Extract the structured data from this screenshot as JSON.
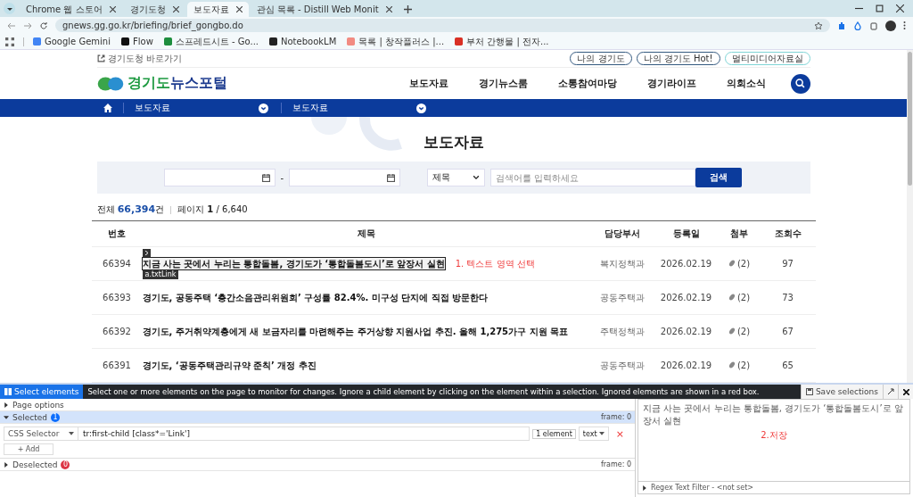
{
  "browser": {
    "tabs": [
      {
        "title": "Chrome 웹 스토어",
        "selected": false
      },
      {
        "title": "경기도청",
        "selected": false
      },
      {
        "title": "보도자료",
        "selected": true
      },
      {
        "title": "관심 목록 - Distill Web Monit",
        "selected": false
      }
    ],
    "url": "gnews.gg.go.kr/briefing/brief_gongbo.do",
    "bookmarks": [
      {
        "label": "Google Gemini"
      },
      {
        "label": "Flow"
      },
      {
        "label": "스프레드시트 - Go..."
      },
      {
        "label": "NotebookLM"
      },
      {
        "label": "목록 | 창작플러스 |..."
      },
      {
        "label": "부처 간행물 | 전자..."
      }
    ]
  },
  "site": {
    "top_link": "경기도청 바로가기",
    "top_buttons": [
      "나의 경기도",
      "나의 경기도 Hot!",
      "멀티미디어자료실"
    ],
    "logo": {
      "primary": "경기도",
      "secondary": "뉴스포털"
    },
    "menu": [
      "보도자료",
      "경기뉴스룸",
      "소통참여마당",
      "경기라이프",
      "의회소식"
    ],
    "breadcrumb": [
      "보도자료",
      "보도자료"
    ],
    "page_title": "보도자료",
    "search": {
      "date_separator": "-",
      "field_select": "제목",
      "placeholder": "검색어를 입력하세요",
      "button": "검색"
    },
    "summary": {
      "total_label": "전체",
      "total_count": "66,394",
      "total_unit": "건",
      "page_label": "페이지",
      "page_current": "1",
      "page_total": "/ 6,640"
    },
    "table": {
      "columns": [
        "번호",
        "제목",
        "담당부서",
        "등록일",
        "첨부",
        "조회수"
      ],
      "rows": [
        {
          "number": "66394",
          "title": "지금 사는 곳에서 누리는 통합돌봄, 경기도가 ‘통합돌봄도시’로 앞장서 실현",
          "department": "복지정책과",
          "date": "2026.02.19",
          "attachments": "(2)",
          "views": "97",
          "selected": true
        },
        {
          "number": "66393",
          "title": "경기도, 공동주택 ‘층간소음관리위원회’ 구성률 82.4%. 미구성 단지에 직접 방문한다",
          "department": "공동주택과",
          "date": "2026.02.19",
          "attachments": "(2)",
          "views": "73",
          "selected": false
        },
        {
          "number": "66392",
          "title": "경기도, 주거취약계층에게 새 보금자리를 마련해주는 주거상향 지원사업 추진. 올해 1,275가구 지원 목표",
          "department": "주택정책과",
          "date": "2026.02.19",
          "attachments": "(2)",
          "views": "67",
          "selected": false
        },
        {
          "number": "66391",
          "title": "경기도, ‘공동주택관리규약 준칙’ 개정 추진",
          "department": "공동주택과",
          "date": "2026.02.19",
          "attachments": "(2)",
          "views": "65",
          "selected": false
        }
      ]
    },
    "selection_label": "a.txtLink",
    "annotation": "1. 텍스트 영역 선택"
  },
  "distill": {
    "select_button": "Select elements",
    "message": "Select one or more elements on the page to monitor for changes. Ignore a child element by clicking on the element within a selection. Ignored elements are shown in a red box.",
    "save_button": "Save selections",
    "sections": [
      {
        "title": "Page options",
        "expanded": false
      },
      {
        "title": "Selected",
        "expanded": true,
        "count": "1",
        "color": "#0d6efd",
        "frame": "frame: 0"
      },
      {
        "title": "Deselected",
        "expanded": false,
        "count": "0",
        "color": "#dc3545",
        "frame": "frame: 0"
      }
    ],
    "selector": {
      "type": "CSS Selector",
      "value": "tr:first-child [class*='Link']",
      "match_count": "1 element",
      "output": "text",
      "delete": "×"
    },
    "add_button": "+ Add",
    "preview": "지금 사는 곳에서 누리는 통합돌봄, 경기도가 ‘통합돌봄도시’로 앞장서 실현",
    "annotation": "2.저장",
    "regex_filter": "Regex Text Filter - <not set>"
  }
}
